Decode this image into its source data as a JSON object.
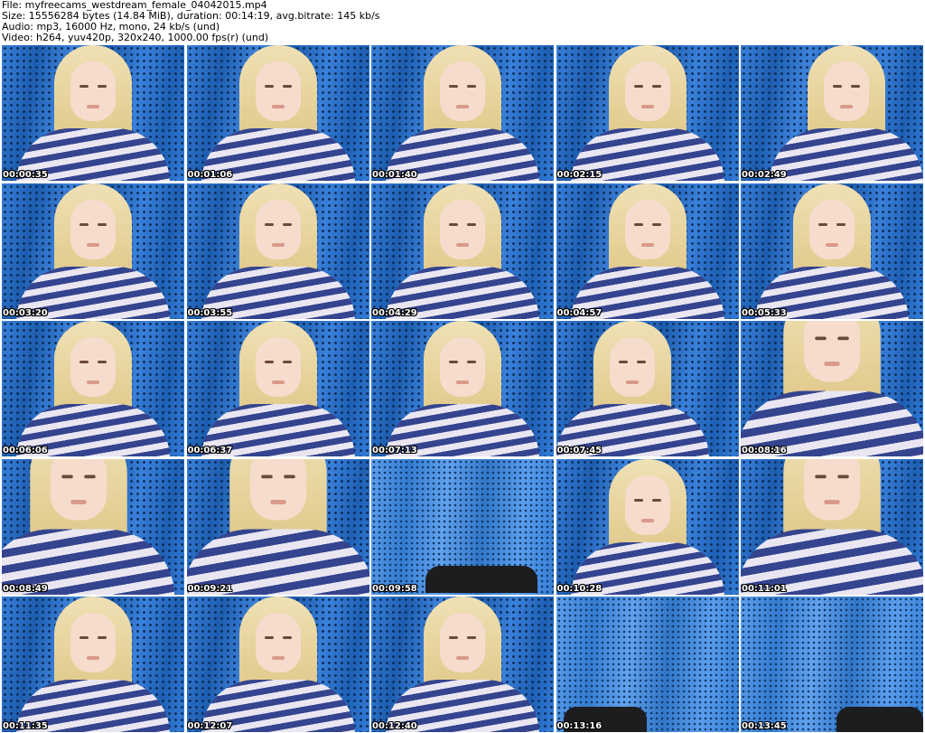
{
  "header": {
    "file_line": "File: myfreecams_westdream_female_04042015.mp4",
    "size_line": "Size: 15556284 bytes (14.84 MiB), duration: 00:14:19, avg.bitrate: 145 kb/s",
    "audio_line": "Audio: mp3, 16000 Hz, mono, 24 kb/s (und)",
    "video_line": "Video: h264, yuv420p, 320x240, 1000.00 fps(r) (und)"
  },
  "thumbnails": [
    {
      "timestamp": "00:00:35"
    },
    {
      "timestamp": "00:01:06"
    },
    {
      "timestamp": "00:01:40"
    },
    {
      "timestamp": "00:02:15"
    },
    {
      "timestamp": "00:02:49"
    },
    {
      "timestamp": "00:03:20"
    },
    {
      "timestamp": "00:03:55"
    },
    {
      "timestamp": "00:04:29"
    },
    {
      "timestamp": "00:04:57"
    },
    {
      "timestamp": "00:05:33"
    },
    {
      "timestamp": "00:06:06"
    },
    {
      "timestamp": "00:06:37"
    },
    {
      "timestamp": "00:07:13"
    },
    {
      "timestamp": "00:07:45"
    },
    {
      "timestamp": "00:08:16"
    },
    {
      "timestamp": "00:08:49"
    },
    {
      "timestamp": "00:09:21"
    },
    {
      "timestamp": "00:09:58"
    },
    {
      "timestamp": "00:10:28"
    },
    {
      "timestamp": "00:11:01"
    },
    {
      "timestamp": "00:11:35"
    },
    {
      "timestamp": "00:12:07"
    },
    {
      "timestamp": "00:12:40"
    },
    {
      "timestamp": "00:13:16"
    },
    {
      "timestamp": "00:13:45"
    }
  ],
  "colors": {
    "page_background": "#ffffff",
    "backdrop_blue": "#2372d6",
    "sweater_stripe_navy": "#34448e",
    "sweater_stripe_white": "#e9e6f2",
    "hair_blonde": "#e4cf95",
    "timestamp_text": "#ffffff"
  }
}
